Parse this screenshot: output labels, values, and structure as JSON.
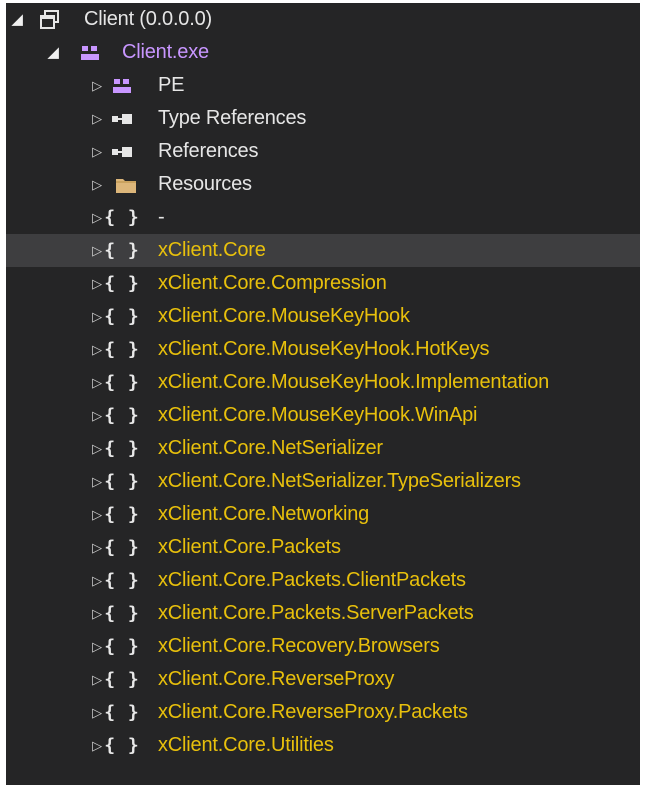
{
  "tree": {
    "assembly": {
      "label": "Client (0.0.0.0)",
      "icon": "assembly-icon"
    },
    "module": {
      "label": "Client.exe",
      "icon": "module-icon"
    },
    "children": [
      {
        "label": "PE",
        "icon": "pe-icon"
      },
      {
        "label": "Type References",
        "icon": "references-icon"
      },
      {
        "label": "References",
        "icon": "references-icon"
      },
      {
        "label": "Resources",
        "icon": "folder-icon"
      },
      {
        "label": "-",
        "icon": "namespace-icon"
      }
    ],
    "namespaces": [
      {
        "label": "xClient.Core",
        "selected": true
      },
      {
        "label": "xClient.Core.Compression"
      },
      {
        "label": "xClient.Core.MouseKeyHook"
      },
      {
        "label": "xClient.Core.MouseKeyHook.HotKeys"
      },
      {
        "label": "xClient.Core.MouseKeyHook.Implementation"
      },
      {
        "label": "xClient.Core.MouseKeyHook.WinApi"
      },
      {
        "label": "xClient.Core.NetSerializer"
      },
      {
        "label": "xClient.Core.NetSerializer.TypeSerializers"
      },
      {
        "label": "xClient.Core.Networking"
      },
      {
        "label": "xClient.Core.Packets"
      },
      {
        "label": "xClient.Core.Packets.ClientPackets"
      },
      {
        "label": "xClient.Core.Packets.ServerPackets"
      },
      {
        "label": "xClient.Core.Recovery.Browsers"
      },
      {
        "label": "xClient.Core.ReverseProxy"
      },
      {
        "label": "xClient.Core.ReverseProxy.Packets"
      },
      {
        "label": "xClient.Core.Utilities"
      }
    ],
    "namespace_icon_glyph": "{ }",
    "colors": {
      "background": "#252526",
      "selected": "#3e3e40",
      "text": "#e6e6e6",
      "module": "#c896ff",
      "namespace": "#e8c00c"
    }
  }
}
